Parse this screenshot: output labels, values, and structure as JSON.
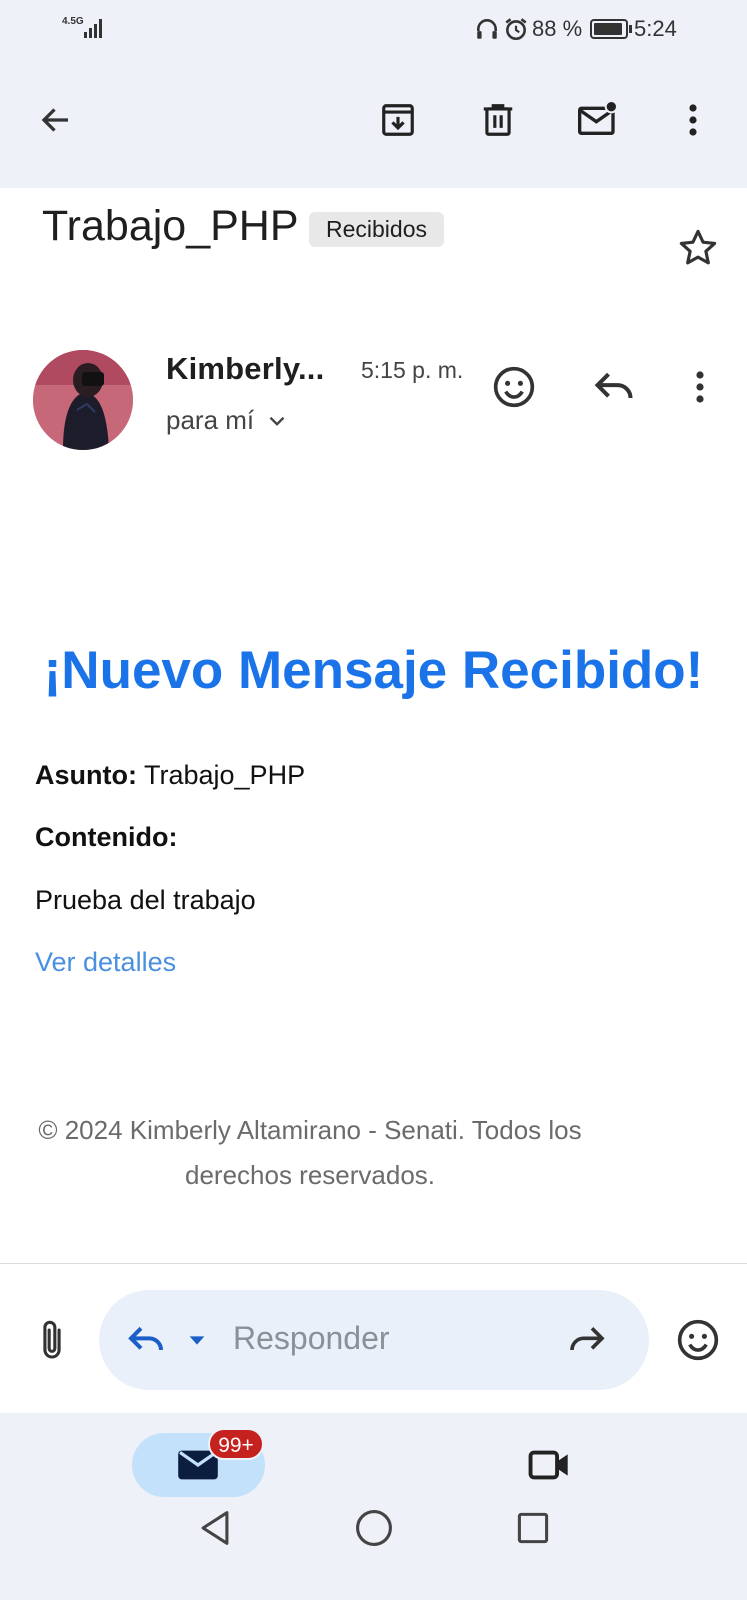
{
  "status_bar": {
    "network": "4.5G",
    "battery": "88 %",
    "time": "5:24"
  },
  "subject": {
    "title": "Trabajo_PHP",
    "label": "Recibidos"
  },
  "sender": {
    "name": "Kimberly...",
    "time": "5:15 p. m.",
    "recipient": "para mí"
  },
  "message": {
    "heading": "¡Nuevo Mensaje Recibido!",
    "subject_label": "Asunto:",
    "subject_value": "Trabajo_PHP",
    "content_label": "Contenido:",
    "content_value": "Prueba del trabajo",
    "link": "Ver detalles",
    "footer": "© 2024 Kimberly Altamirano - Senati. Todos los derechos reservados."
  },
  "reply_bar": {
    "placeholder": "Responder"
  },
  "nav": {
    "mail_badge": "99+"
  },
  "colors": {
    "accent": "#1a73e8",
    "link": "#4a8fe0",
    "badge": "#c5221f",
    "mail_pill": "#c3e1fb"
  },
  "icons": [
    "back-arrow-icon",
    "archive-icon",
    "trash-icon",
    "mark-unread-icon",
    "more-vert-icon",
    "star-icon",
    "emoji-icon",
    "reply-icon",
    "chevron-down-icon",
    "attach-icon",
    "forward-icon",
    "mail-icon",
    "video-icon",
    "nav-back-icon",
    "nav-home-icon",
    "nav-recents-icon"
  ]
}
